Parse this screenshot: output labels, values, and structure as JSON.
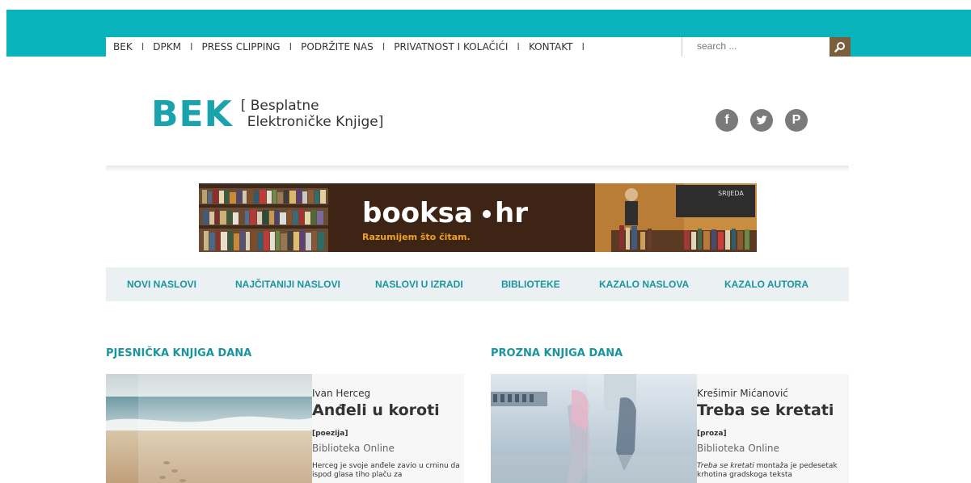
{
  "topnav": {
    "items": [
      "BEK",
      "DPKM",
      "PRESS CLIPPING",
      "PODRŽITE NAS",
      "PRIVATNOST I KOLAČIĆI",
      "KONTAKT"
    ],
    "separator": "I"
  },
  "search": {
    "placeholder": "search ..."
  },
  "logo": {
    "mark": "BEK",
    "line1": "[ Besplatne",
    "line2": "Elektroničke Knjige]"
  },
  "social": [
    "facebook-icon",
    "twitter-icon",
    "pinterest-icon"
  ],
  "banner": {
    "brand": "booksa",
    "domain": "hr",
    "tagline": "Razumijem što čitam.",
    "board_text": "SRIJEDA"
  },
  "mainnav": [
    "NOVI NASLOVI",
    "NAJČITANIJI NASLOVI",
    "NASLOVI U IZRADI",
    "BIBLIOTEKE",
    "KAZALO NASLOVA",
    "KAZALO AUTORA"
  ],
  "sections": {
    "poetry": {
      "title": "PJESNIČKA KNJIGA DANA",
      "author": "Ivan Herceg",
      "book_title": "Anđeli u koroti",
      "genre": "[poezija]",
      "library": "Biblioteka Online",
      "description": "Herceg je svoje anđele zavio u crninu da ispod glasa tiho plaču za"
    },
    "prose": {
      "title": "PROZNA KNJIGA DANA",
      "author": "Krešimir Mićanović",
      "book_title": "Treba se kretati",
      "genre": "[proza]",
      "library": "Biblioteka Online",
      "description_em": "Treba se kretati",
      "description": " montaža je pedesetak krhotina gradskoga teksta"
    }
  },
  "colors": {
    "accent": "#08b3bc",
    "teal_text": "#1a95a0",
    "search_button": "#7b5e3c",
    "social": "#7a7a7a"
  }
}
